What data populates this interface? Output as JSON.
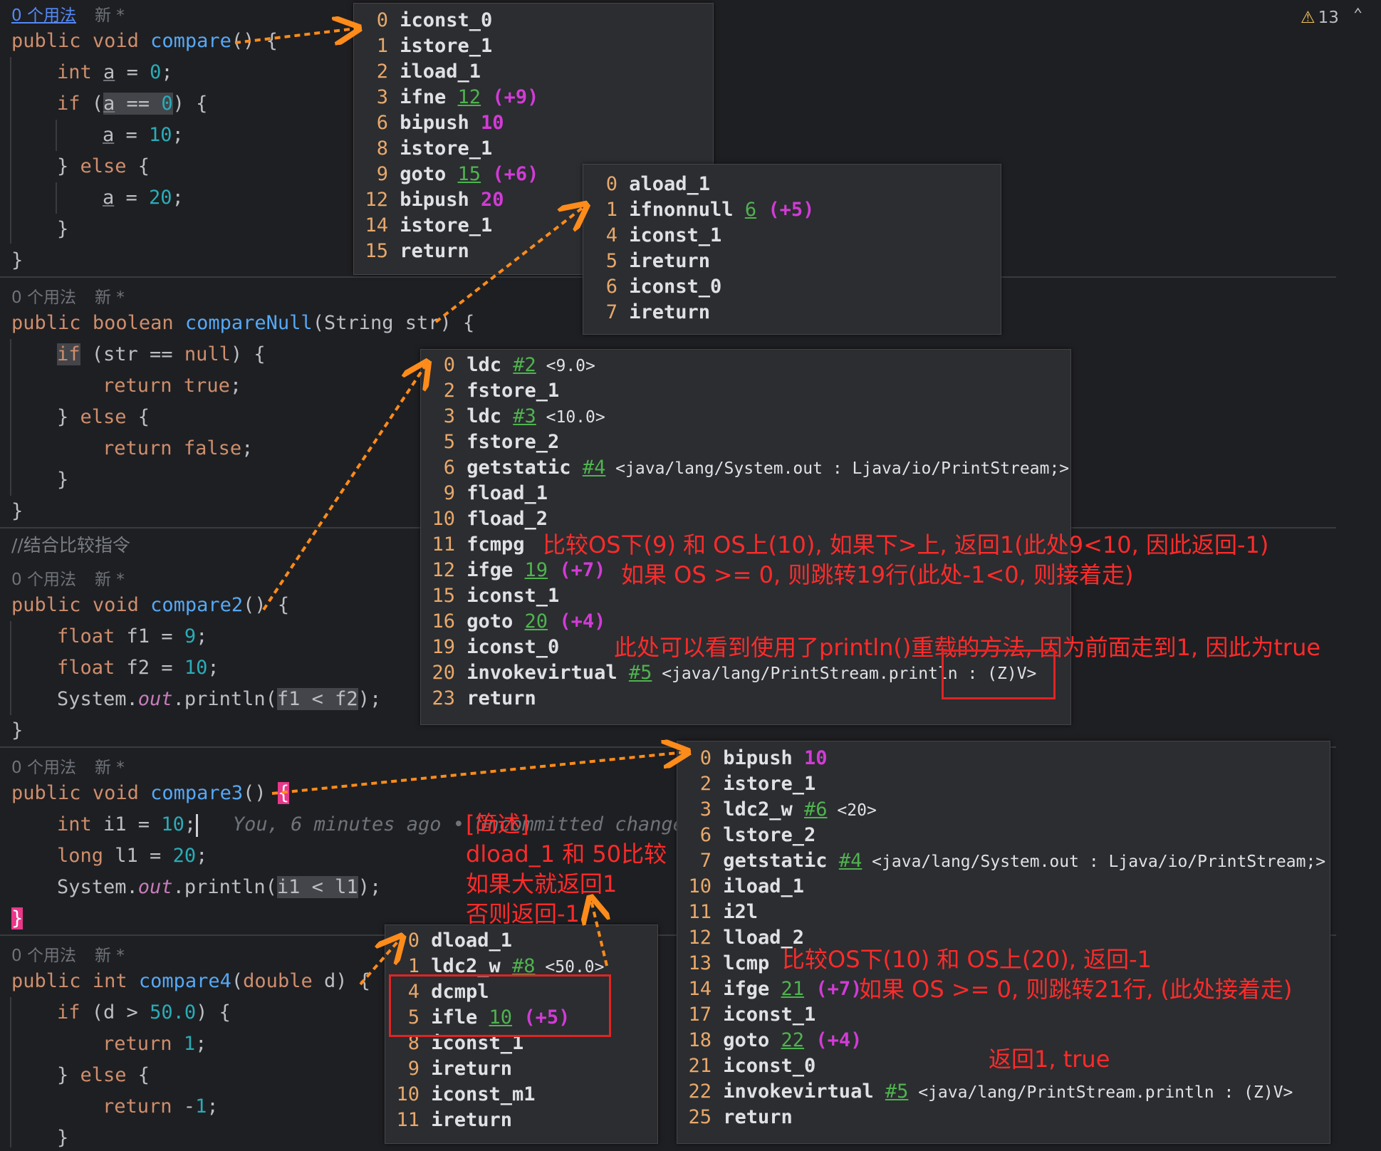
{
  "warning": {
    "count": "13"
  },
  "usage": {
    "usages": "0 个用法",
    "new": "新 *"
  },
  "comment": "//结合比较指令",
  "blame": "You, 6 minutes ago • Uncommitted changes",
  "bytecode": {
    "compare": [
      {
        "off": "0",
        "op": "iconst_0"
      },
      {
        "off": "1",
        "op": "istore_1"
      },
      {
        "off": "2",
        "op": "iload_1"
      },
      {
        "off": "3",
        "op": "ifne",
        "arg": "12",
        "jmp": "(+9)"
      },
      {
        "off": "6",
        "op": "bipush",
        "num": "10"
      },
      {
        "off": "8",
        "op": "istore_1"
      },
      {
        "off": "9",
        "op": "goto",
        "arg": "15",
        "jmp": "(+6)"
      },
      {
        "off": "12",
        "op": "bipush",
        "num": "20"
      },
      {
        "off": "14",
        "op": "istore_1"
      },
      {
        "off": "15",
        "op": "return"
      }
    ],
    "compareNull": [
      {
        "off": "0",
        "op": "aload_1"
      },
      {
        "off": "1",
        "op": "ifnonnull",
        "arg": "6",
        "jmp": "(+5)"
      },
      {
        "off": "4",
        "op": "iconst_1"
      },
      {
        "off": "5",
        "op": "ireturn"
      },
      {
        "off": "6",
        "op": "iconst_0"
      },
      {
        "off": "7",
        "op": "ireturn"
      }
    ],
    "compare2": [
      {
        "off": "0",
        "op": "ldc",
        "arg": "#2",
        "cmt": "<9.0>"
      },
      {
        "off": "2",
        "op": "fstore_1"
      },
      {
        "off": "3",
        "op": "ldc",
        "arg": "#3",
        "cmt": "<10.0>"
      },
      {
        "off": "5",
        "op": "fstore_2"
      },
      {
        "off": "6",
        "op": "getstatic",
        "arg": "#4",
        "cmt": "<java/lang/System.out : Ljava/io/PrintStream;>"
      },
      {
        "off": "9",
        "op": "fload_1"
      },
      {
        "off": "10",
        "op": "fload_2"
      },
      {
        "off": "11",
        "op": "fcmpg"
      },
      {
        "off": "12",
        "op": "ifge",
        "arg": "19",
        "jmp": "(+7)"
      },
      {
        "off": "15",
        "op": "iconst_1"
      },
      {
        "off": "16",
        "op": "goto",
        "arg": "20",
        "jmp": "(+4)"
      },
      {
        "off": "19",
        "op": "iconst_0"
      },
      {
        "off": "20",
        "op": "invokevirtual",
        "arg": "#5",
        "cmt": "<java/lang/PrintStream.println : (Z)V>"
      },
      {
        "off": "23",
        "op": "return"
      }
    ],
    "compare3": [
      {
        "off": "0",
        "op": "bipush",
        "num": "10"
      },
      {
        "off": "2",
        "op": "istore_1"
      },
      {
        "off": "3",
        "op": "ldc2_w",
        "arg": "#6",
        "cmt": "<20>"
      },
      {
        "off": "6",
        "op": "lstore_2"
      },
      {
        "off": "7",
        "op": "getstatic",
        "arg": "#4",
        "cmt": "<java/lang/System.out : Ljava/io/PrintStream;>"
      },
      {
        "off": "10",
        "op": "iload_1"
      },
      {
        "off": "11",
        "op": "i2l"
      },
      {
        "off": "12",
        "op": "lload_2"
      },
      {
        "off": "13",
        "op": "lcmp"
      },
      {
        "off": "14",
        "op": "ifge",
        "arg": "21",
        "jmp": "(+7)"
      },
      {
        "off": "17",
        "op": "iconst_1"
      },
      {
        "off": "18",
        "op": "goto",
        "arg": "22",
        "jmp": "(+4)"
      },
      {
        "off": "21",
        "op": "iconst_0"
      },
      {
        "off": "22",
        "op": "invokevirtual",
        "arg": "#5",
        "cmt": "<java/lang/PrintStream.println : (Z)V>"
      },
      {
        "off": "25",
        "op": "return"
      }
    ],
    "compare4": [
      {
        "off": "0",
        "op": "dload_1"
      },
      {
        "off": "1",
        "op": "ldc2_w",
        "arg": "#8",
        "cmt": "<50.0>"
      },
      {
        "off": "4",
        "op": "dcmpl"
      },
      {
        "off": "5",
        "op": "ifle",
        "arg": "10",
        "jmp": "(+5)"
      },
      {
        "off": "8",
        "op": "iconst_1"
      },
      {
        "off": "9",
        "op": "ireturn"
      },
      {
        "off": "10",
        "op": "iconst_m1"
      },
      {
        "off": "11",
        "op": "ireturn"
      }
    ]
  },
  "notes": {
    "fcmpg": "比较OS下(9) 和 OS上(10), 如果下>上, 返回1(此处9<10, 因此返回-1)",
    "ifge2": "如果 OS >= 0, 则跳转19行(此处-1<0, 则接着走)",
    "println": "此处可以看到使用了println()重载的方法, 因为前面走到1, 因此为true",
    "lcmp": "比较OS下(10) 和 OS上(20), 返回-1",
    "ifge3": "如果 OS >= 0, 则跳转21行, (此处接着走)",
    "ret3": "返回1, true",
    "brief": "[简述]\ndload_1 和 50比较\n如果大就返回1\n否则返回-1"
  }
}
